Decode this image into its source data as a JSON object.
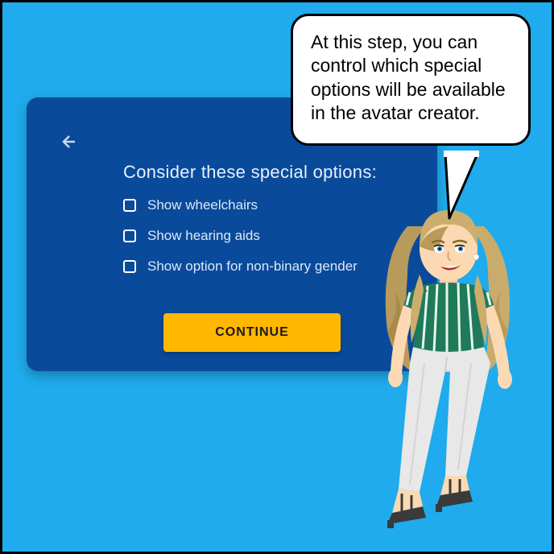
{
  "card": {
    "heading": "Consider these special options:",
    "options": [
      {
        "label": "Show wheelchairs"
      },
      {
        "label": "Show hearing aids"
      },
      {
        "label": "Show option for non-binary gender"
      }
    ],
    "continue_label": "CONTINUE"
  },
  "bubble": {
    "text": "At this step, you can control which special options will be available in the avatar creator."
  }
}
